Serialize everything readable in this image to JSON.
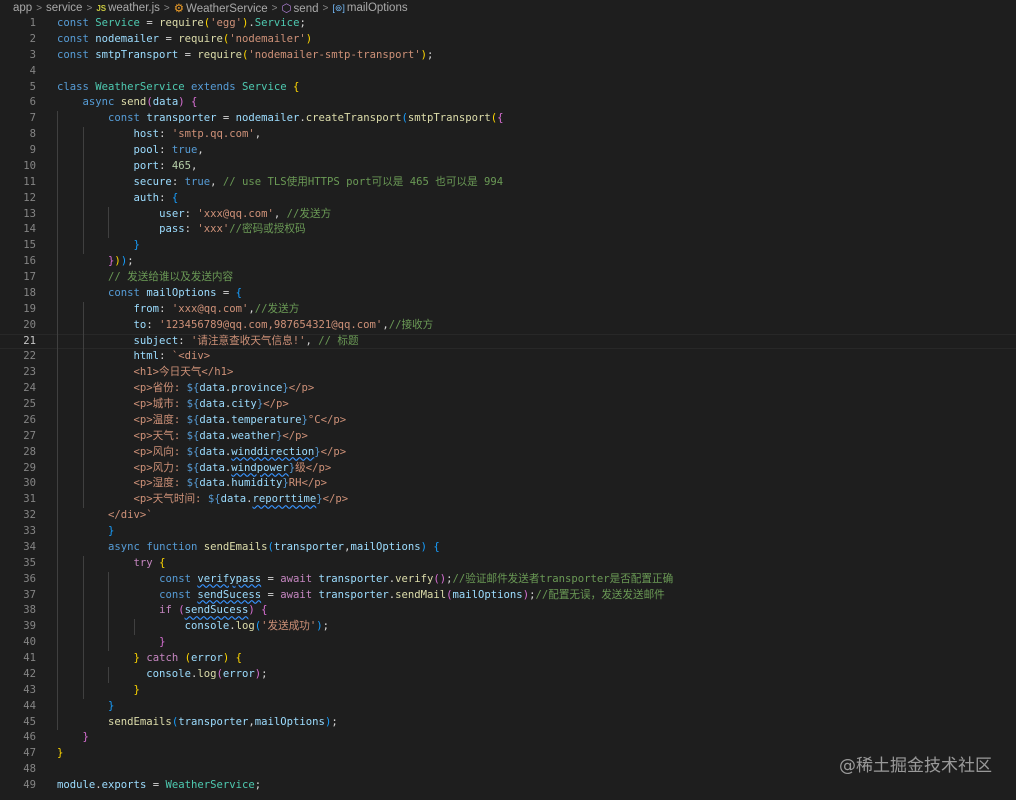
{
  "breadcrumb": {
    "items": [
      "app",
      "service",
      "weather.js",
      "WeatherService",
      "send",
      "mailOptions"
    ],
    "icons": {
      "file": "JS"
    }
  },
  "active_line": 21,
  "code": {
    "lines": [
      [
        [
          "k",
          "const "
        ],
        [
          "t",
          "Service"
        ],
        [
          "p",
          " = "
        ],
        [
          "f",
          "require"
        ],
        [
          "b1",
          "("
        ],
        [
          "s",
          "'egg'"
        ],
        [
          "b1",
          ")"
        ],
        [
          "p",
          "."
        ],
        [
          "t",
          "Service"
        ],
        [
          "p",
          ";"
        ]
      ],
      [
        [
          "k",
          "const "
        ],
        [
          "v",
          "nodemailer"
        ],
        [
          "p",
          " = "
        ],
        [
          "f",
          "require"
        ],
        [
          "b1",
          "("
        ],
        [
          "s",
          "'nodemailer'"
        ],
        [
          "b1",
          ")"
        ]
      ],
      [
        [
          "k",
          "const "
        ],
        [
          "v",
          "smtpTransport"
        ],
        [
          "p",
          " = "
        ],
        [
          "f",
          "require"
        ],
        [
          "b1",
          "("
        ],
        [
          "s",
          "'nodemailer-smtp-transport'"
        ],
        [
          "b1",
          ")"
        ],
        [
          "p",
          ";"
        ]
      ],
      [],
      [
        [
          "k",
          "class "
        ],
        [
          "t",
          "WeatherService "
        ],
        [
          "k",
          "extends "
        ],
        [
          "t",
          "Service "
        ],
        [
          "b1",
          "{"
        ]
      ],
      [
        [
          "p",
          "    "
        ],
        [
          "k",
          "async "
        ],
        [
          "f",
          "send"
        ],
        [
          "b2",
          "("
        ],
        [
          "v",
          "data"
        ],
        [
          "b2",
          ")"
        ],
        [
          "p",
          " "
        ],
        [
          "b2",
          "{"
        ]
      ],
      [
        [
          "p",
          "        "
        ],
        [
          "k",
          "const "
        ],
        [
          "v",
          "transporter"
        ],
        [
          "p",
          " = "
        ],
        [
          "v",
          "nodemailer"
        ],
        [
          "p",
          "."
        ],
        [
          "f",
          "createTransport"
        ],
        [
          "b3",
          "("
        ],
        [
          "f",
          "smtpTransport"
        ],
        [
          "b1",
          "("
        ],
        [
          "b2",
          "{"
        ]
      ],
      [
        [
          "p",
          "            "
        ],
        [
          "v",
          "host"
        ],
        [
          "p",
          ": "
        ],
        [
          "s",
          "'smtp.qq.com'"
        ],
        [
          "p",
          ","
        ]
      ],
      [
        [
          "p",
          "            "
        ],
        [
          "v",
          "pool"
        ],
        [
          "p",
          ": "
        ],
        [
          "k",
          "true"
        ],
        [
          "p",
          ","
        ]
      ],
      [
        [
          "p",
          "            "
        ],
        [
          "v",
          "port"
        ],
        [
          "p",
          ": "
        ],
        [
          "n",
          "465"
        ],
        [
          "p",
          ","
        ]
      ],
      [
        [
          "p",
          "            "
        ],
        [
          "v",
          "secure"
        ],
        [
          "p",
          ": "
        ],
        [
          "k",
          "true"
        ],
        [
          "p",
          ", "
        ],
        [
          "m",
          "// use TLS使用HTTPS port可以是 465 也可以是 994"
        ]
      ],
      [
        [
          "p",
          "            "
        ],
        [
          "v",
          "auth"
        ],
        [
          "p",
          ": "
        ],
        [
          "b3",
          "{"
        ]
      ],
      [
        [
          "p",
          "                "
        ],
        [
          "v",
          "user"
        ],
        [
          "p",
          ": "
        ],
        [
          "s",
          "'xxx@qq.com'"
        ],
        [
          "p",
          ", "
        ],
        [
          "m",
          "//发送方"
        ]
      ],
      [
        [
          "p",
          "                "
        ],
        [
          "v",
          "pass"
        ],
        [
          "p",
          ": "
        ],
        [
          "s",
          "'xxx'"
        ],
        [
          "m",
          "//密码或授权码"
        ]
      ],
      [
        [
          "p",
          "            "
        ],
        [
          "b3",
          "}"
        ]
      ],
      [
        [
          "p",
          "        "
        ],
        [
          "b2",
          "}"
        ],
        [
          "b1",
          ")"
        ],
        [
          "b3",
          ")"
        ],
        [
          "p",
          ";"
        ]
      ],
      [
        [
          "p",
          "        "
        ],
        [
          "m",
          "// 发送给谁以及发送内容"
        ]
      ],
      [
        [
          "p",
          "        "
        ],
        [
          "k",
          "const "
        ],
        [
          "v",
          "mailOptions"
        ],
        [
          "p",
          " = "
        ],
        [
          "b3",
          "{"
        ]
      ],
      [
        [
          "p",
          "            "
        ],
        [
          "v",
          "from"
        ],
        [
          "p",
          ": "
        ],
        [
          "s",
          "'xxx@qq.com'"
        ],
        [
          "p",
          ","
        ],
        [
          "m",
          "//发送方"
        ]
      ],
      [
        [
          "p",
          "            "
        ],
        [
          "v",
          "to"
        ],
        [
          "p",
          ": "
        ],
        [
          "s",
          "'123456789@qq.com,987654321@qq.com'"
        ],
        [
          "p",
          ","
        ],
        [
          "m",
          "//接收方"
        ]
      ],
      [
        [
          "p",
          "            "
        ],
        [
          "v",
          "subject"
        ],
        [
          "p",
          ": "
        ],
        [
          "s",
          "'请注意查收天气信息!'"
        ],
        [
          "p",
          ", "
        ],
        [
          "m",
          "// 标题"
        ]
      ],
      [
        [
          "p",
          "            "
        ],
        [
          "v",
          "html"
        ],
        [
          "p",
          ": "
        ],
        [
          "s",
          "`<div>"
        ]
      ],
      [
        [
          "p",
          "            "
        ],
        [
          "s",
          "<h1>今日天气</h1>"
        ]
      ],
      [
        [
          "p",
          "            "
        ],
        [
          "s",
          "<p>省份: "
        ],
        [
          "k",
          "${"
        ],
        [
          "v",
          "data"
        ],
        [
          "p",
          "."
        ],
        [
          "v",
          "province"
        ],
        [
          "k",
          "}"
        ],
        [
          "s",
          "</p>"
        ]
      ],
      [
        [
          "p",
          "            "
        ],
        [
          "s",
          "<p>城市: "
        ],
        [
          "k",
          "${"
        ],
        [
          "v",
          "data"
        ],
        [
          "p",
          "."
        ],
        [
          "v",
          "city"
        ],
        [
          "k",
          "}"
        ],
        [
          "s",
          "</p>"
        ]
      ],
      [
        [
          "p",
          "            "
        ],
        [
          "s",
          "<p>温度: "
        ],
        [
          "k",
          "${"
        ],
        [
          "v",
          "data"
        ],
        [
          "p",
          "."
        ],
        [
          "v",
          "temperature"
        ],
        [
          "k",
          "}"
        ],
        [
          "s",
          "°C</p>"
        ]
      ],
      [
        [
          "p",
          "            "
        ],
        [
          "s",
          "<p>天气: "
        ],
        [
          "k",
          "${"
        ],
        [
          "v",
          "data"
        ],
        [
          "p",
          "."
        ],
        [
          "v",
          "weather"
        ],
        [
          "k",
          "}"
        ],
        [
          "s",
          "</p>"
        ]
      ],
      [
        [
          "p",
          "            "
        ],
        [
          "s",
          "<p>风向: "
        ],
        [
          "k",
          "${"
        ],
        [
          "v",
          "data"
        ],
        [
          "p",
          "."
        ],
        [
          "v sq",
          "winddirection"
        ],
        [
          "k",
          "}"
        ],
        [
          "s",
          "</p>"
        ]
      ],
      [
        [
          "p",
          "            "
        ],
        [
          "s",
          "<p>风力: "
        ],
        [
          "k",
          "${"
        ],
        [
          "v",
          "data"
        ],
        [
          "p",
          "."
        ],
        [
          "v sq",
          "windpower"
        ],
        [
          "k",
          "}"
        ],
        [
          "s",
          "级</p>"
        ]
      ],
      [
        [
          "p",
          "            "
        ],
        [
          "s",
          "<p>湿度: "
        ],
        [
          "k",
          "${"
        ],
        [
          "v",
          "data"
        ],
        [
          "p",
          "."
        ],
        [
          "v",
          "humidity"
        ],
        [
          "k",
          "}"
        ],
        [
          "s",
          "RH</p>"
        ]
      ],
      [
        [
          "p",
          "            "
        ],
        [
          "s",
          "<p>天气时间: "
        ],
        [
          "k",
          "${"
        ],
        [
          "v",
          "data"
        ],
        [
          "p",
          "."
        ],
        [
          "v sq",
          "reporttime"
        ],
        [
          "k",
          "}"
        ],
        [
          "s",
          "</p>"
        ]
      ],
      [
        [
          "p",
          "        "
        ],
        [
          "s",
          "</div>`"
        ]
      ],
      [
        [
          "p",
          "        "
        ],
        [
          "b3",
          "}"
        ]
      ],
      [
        [
          "p",
          "        "
        ],
        [
          "k",
          "async "
        ],
        [
          "k",
          "function "
        ],
        [
          "f",
          "sendEmails"
        ],
        [
          "b3",
          "("
        ],
        [
          "v",
          "transporter"
        ],
        [
          "p",
          ","
        ],
        [
          "v",
          "mailOptions"
        ],
        [
          "b3",
          ")"
        ],
        [
          "p",
          " "
        ],
        [
          "b3",
          "{"
        ]
      ],
      [
        [
          "p",
          "            "
        ],
        [
          "c",
          "try "
        ],
        [
          "b1",
          "{"
        ]
      ],
      [
        [
          "p",
          "                "
        ],
        [
          "k",
          "const "
        ],
        [
          "v sq",
          "verifypass"
        ],
        [
          "p",
          " = "
        ],
        [
          "c",
          "await "
        ],
        [
          "v",
          "transporter"
        ],
        [
          "p",
          "."
        ],
        [
          "f",
          "verify"
        ],
        [
          "b2",
          "()"
        ],
        [
          "p",
          ";"
        ],
        [
          "m",
          "//验证邮件发送者transporter是否配置正确"
        ]
      ],
      [
        [
          "p",
          "                "
        ],
        [
          "k",
          "const "
        ],
        [
          "v sq",
          "sendSucess"
        ],
        [
          "p",
          " = "
        ],
        [
          "c",
          "await "
        ],
        [
          "v",
          "transporter"
        ],
        [
          "p",
          "."
        ],
        [
          "f",
          "sendMail"
        ],
        [
          "b2",
          "("
        ],
        [
          "v",
          "mailOptions"
        ],
        [
          "b2",
          ")"
        ],
        [
          "p",
          ";"
        ],
        [
          "m",
          "//配置无误，发送发送邮件"
        ]
      ],
      [
        [
          "p",
          "                "
        ],
        [
          "c",
          "if "
        ],
        [
          "b2",
          "("
        ],
        [
          "v sq",
          "sendSucess"
        ],
        [
          "b2",
          ")"
        ],
        [
          "p",
          " "
        ],
        [
          "b2",
          "{"
        ]
      ],
      [
        [
          "p",
          "                    "
        ],
        [
          "v",
          "console"
        ],
        [
          "p",
          "."
        ],
        [
          "f",
          "log"
        ],
        [
          "b3",
          "("
        ],
        [
          "s",
          "'发送成功'"
        ],
        [
          "b3",
          ")"
        ],
        [
          "p",
          ";"
        ]
      ],
      [
        [
          "p",
          "                "
        ],
        [
          "b2",
          "}"
        ]
      ],
      [
        [
          "p",
          "            "
        ],
        [
          "b1",
          "}"
        ],
        [
          "p",
          " "
        ],
        [
          "c",
          "catch "
        ],
        [
          "b1",
          "("
        ],
        [
          "v",
          "error"
        ],
        [
          "b1",
          ")"
        ],
        [
          "p",
          " "
        ],
        [
          "b1",
          "{"
        ]
      ],
      [
        [
          "p",
          "              "
        ],
        [
          "v",
          "console"
        ],
        [
          "p",
          "."
        ],
        [
          "f",
          "log"
        ],
        [
          "b2",
          "("
        ],
        [
          "v",
          "error"
        ],
        [
          "b2",
          ")"
        ],
        [
          "p",
          ";"
        ]
      ],
      [
        [
          "p",
          "            "
        ],
        [
          "b1",
          "}"
        ]
      ],
      [
        [
          "p",
          "        "
        ],
        [
          "b3",
          "}"
        ]
      ],
      [
        [
          "p",
          "        "
        ],
        [
          "f",
          "sendEmails"
        ],
        [
          "b3",
          "("
        ],
        [
          "v",
          "transporter"
        ],
        [
          "p",
          ","
        ],
        [
          "v",
          "mailOptions"
        ],
        [
          "b3",
          ")"
        ],
        [
          "p",
          ";"
        ]
      ],
      [
        [
          "p",
          "    "
        ],
        [
          "b2",
          "}"
        ]
      ],
      [
        [
          "b1",
          "}"
        ]
      ],
      [],
      [
        [
          "v",
          "module"
        ],
        [
          "p",
          "."
        ],
        [
          "v",
          "exports"
        ],
        [
          "p",
          " = "
        ],
        [
          "t",
          "WeatherService"
        ],
        [
          "p",
          ";"
        ]
      ]
    ]
  },
  "watermark": "@稀土掘金技术社区"
}
